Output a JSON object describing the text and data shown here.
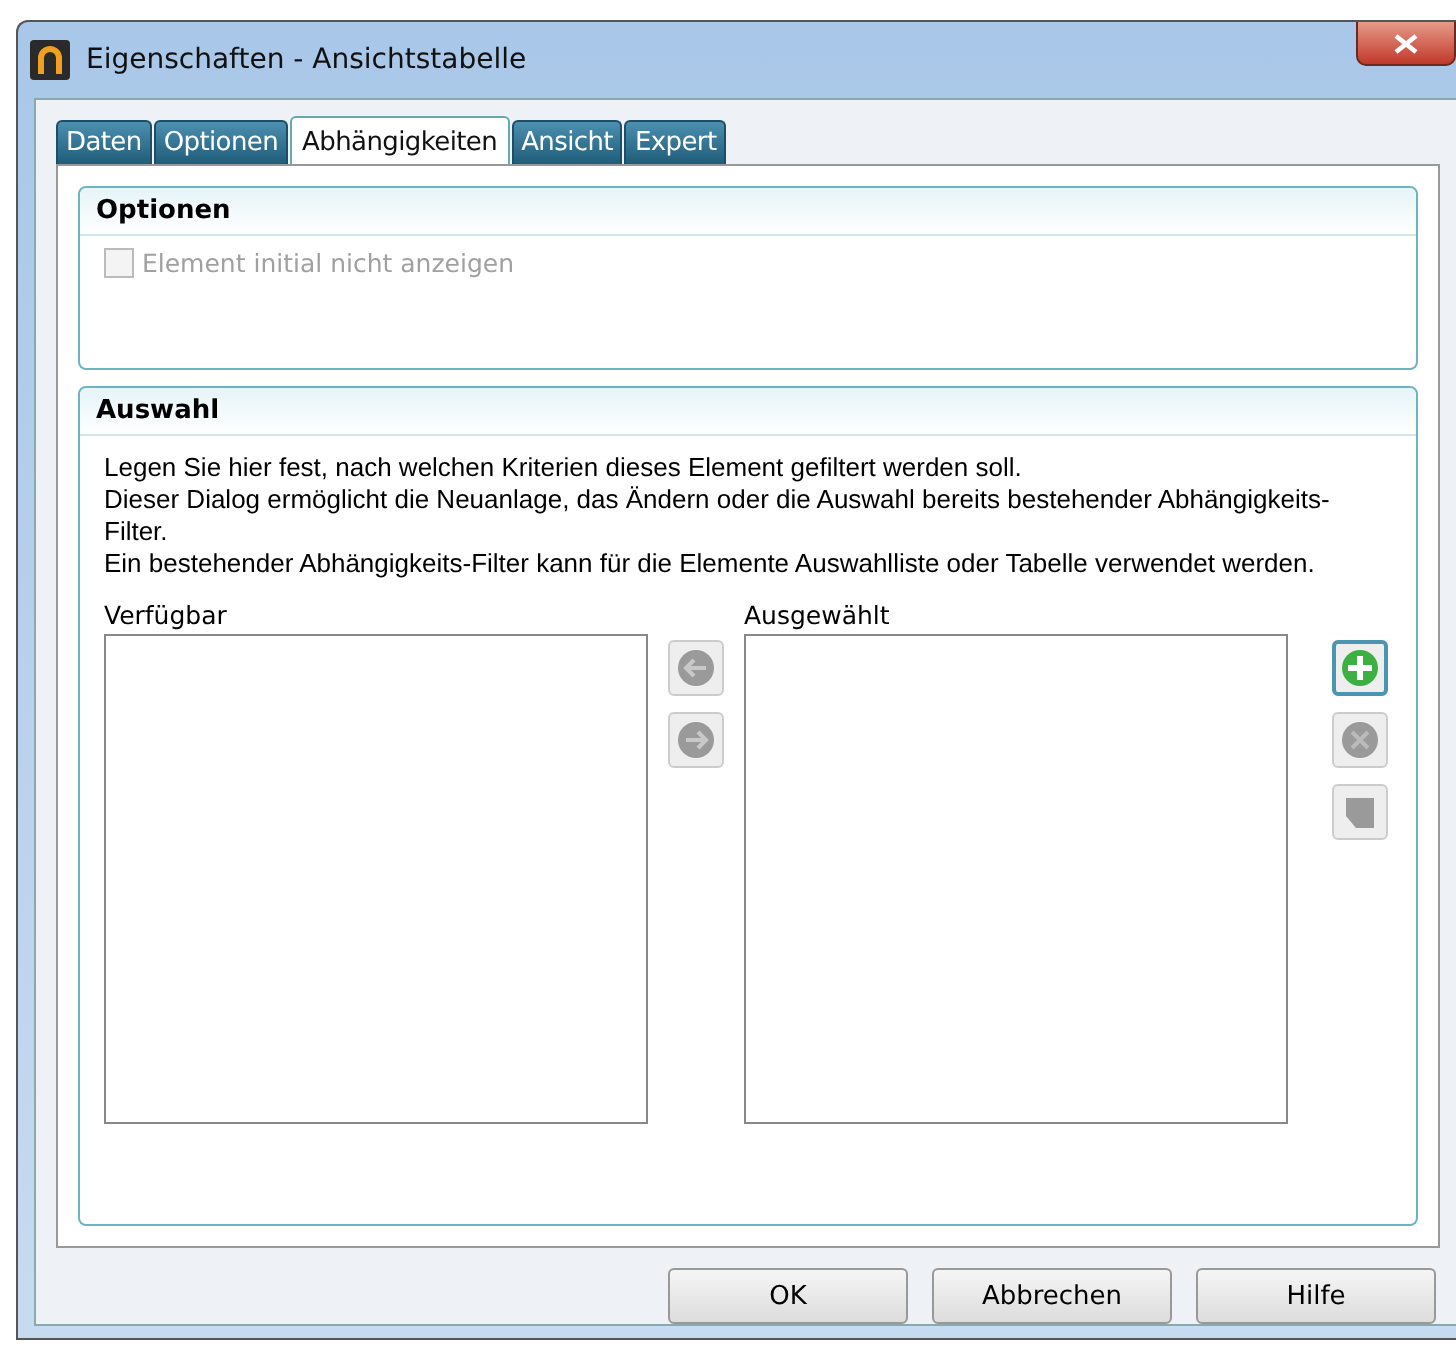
{
  "window": {
    "title": "Eigenschaften - Ansichtstabelle"
  },
  "tabs": [
    {
      "label": "Daten",
      "selected": false
    },
    {
      "label": "Optionen",
      "selected": false
    },
    {
      "label": "Abhängigkeiten",
      "selected": true
    },
    {
      "label": "Ansicht",
      "selected": false
    },
    {
      "label": "Expert",
      "selected": false
    }
  ],
  "options_group": {
    "title": "Optionen",
    "checkbox": {
      "label": "Element initial nicht anzeigen",
      "checked": false,
      "disabled": true
    }
  },
  "selection_group": {
    "title": "Auswahl",
    "description": [
      "Legen Sie hier fest, nach welchen Kriterien dieses Element gefiltert werden soll.",
      "Dieser Dialog ermöglicht die Neuanlage, das Ändern oder die Auswahl bereits bestehender Abhängigkeits-Filter.",
      "Ein bestehender Abhängigkeits-Filter kann für die Elemente Auswahlliste oder Tabelle verwendet werden."
    ],
    "available_label": "Verfügbar",
    "selected_label": "Ausgewählt",
    "move_buttons": [
      {
        "kind": "left",
        "disabled": true
      },
      {
        "kind": "right",
        "disabled": true
      }
    ],
    "tool_buttons": [
      {
        "kind": "add",
        "disabled": false
      },
      {
        "kind": "delete",
        "disabled": true
      },
      {
        "kind": "edit",
        "disabled": true
      }
    ]
  },
  "buttons": [
    "OK",
    "Abbrechen",
    "Hilfe"
  ]
}
